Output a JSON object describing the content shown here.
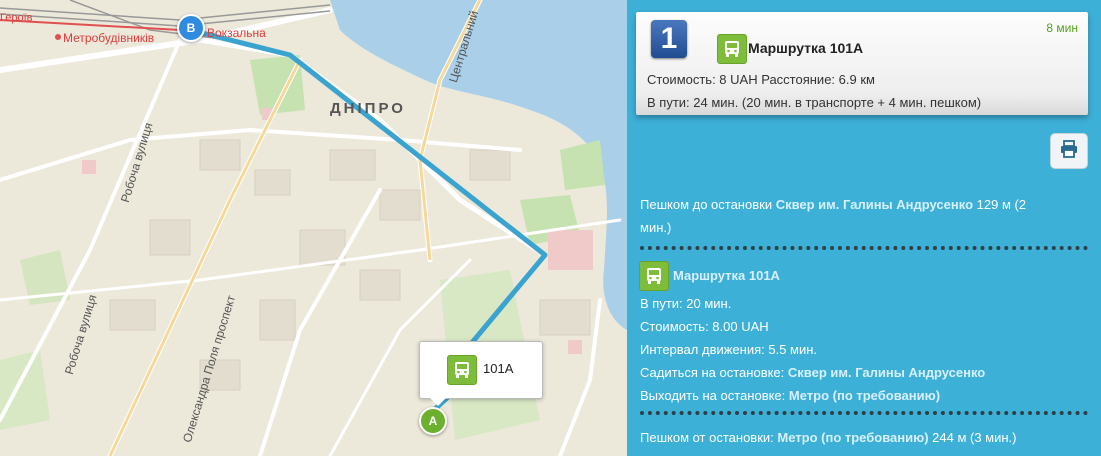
{
  "map": {
    "city_label": "ДНІПРО",
    "metro_label": "Метробудівників",
    "station_label": "Вокзальна",
    "top_left_fragment": "Героїв",
    "streets": {
      "central": "Центральний",
      "robocha_1": "Робоча вулиця",
      "robocha_2": "Робоча вулиця",
      "pola": "Олександра Поля проспект"
    },
    "marker_start": "A",
    "marker_end": "B",
    "popup_label": "101А",
    "route_color": "#3aa3cf"
  },
  "route_card": {
    "number": "1",
    "title": "Маршрутка 101А",
    "duration": "8 мин",
    "cost_line": "Стоимость: 8 UAH Расстояние: 6.9 км",
    "time_line": "В пути: 24 мин. (20 мин. в транспорте + 4 мин. пешком)"
  },
  "print_icon": "printer-icon",
  "steps": {
    "walk_to": {
      "prefix": "Пешком до остановки ",
      "stop": "Сквер им. Галины Андрусенко",
      "suffix_1": " 129 м (2",
      "suffix_2": "мин.)"
    },
    "ride": {
      "title": "Маршрутка 101А",
      "in_transit": "В пути: 20 мин.",
      "cost": "Стоимость: 8.00 UAH",
      "interval": "Интервал движения: 5.5 мин.",
      "board_prefix": "Садиться на остановке: ",
      "board_stop": "Сквер им. Галины Андрусенко",
      "exit_prefix": "Выходить на остановке: ",
      "exit_stop": "Метро (по требованию)"
    },
    "walk_from": {
      "prefix": "Пешком от остановки: ",
      "stop": "Метро (по требованию)",
      "suffix": " 244 м (3 мин.)"
    }
  },
  "colors": {
    "panel": "#3db0d8",
    "accent_green": "#7dbd3a",
    "badge_blue": "#2f5fa8"
  }
}
